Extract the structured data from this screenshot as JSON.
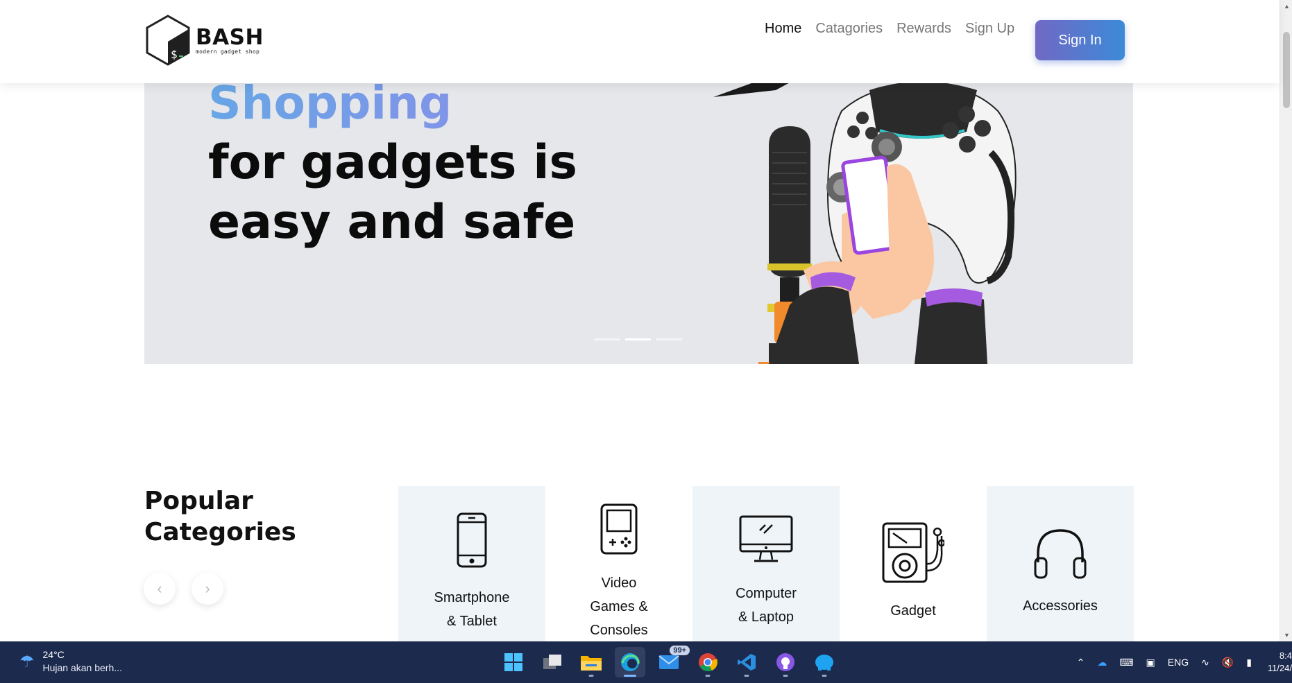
{
  "brand": {
    "name": "BASH",
    "tagline": "modern gadget shop"
  },
  "nav": {
    "items": [
      {
        "label": "Home",
        "active": true
      },
      {
        "label": "Catagories",
        "active": false
      },
      {
        "label": "Rewards",
        "active": false
      },
      {
        "label": "Sign Up",
        "active": false
      }
    ],
    "signin_label": "Sign In"
  },
  "hero": {
    "accent": "Shopping",
    "line1": "for gadgets is",
    "line2": "easy and safe",
    "slides": 3,
    "active_slide": 2
  },
  "popular": {
    "title_line1": "Popular",
    "title_line2": "Categories",
    "prev_icon": "chevron-left-icon",
    "next_icon": "chevron-right-icon",
    "categories": [
      {
        "icon": "smartphone-icon",
        "line1": "Smartphone",
        "line2": "& Tablet"
      },
      {
        "icon": "handheld-console-icon",
        "line1": "Video",
        "line2": "Games &",
        "line3": "Consoles"
      },
      {
        "icon": "desktop-computer-icon",
        "line1": "Computer",
        "line2": "& Laptop"
      },
      {
        "icon": "music-player-icon",
        "line1": "Gadget"
      },
      {
        "icon": "headphones-icon",
        "line1": "Accessories"
      }
    ]
  },
  "taskbar": {
    "weather": {
      "temp": "24°C",
      "desc": "Hujan akan berh..."
    },
    "apps": [
      "windows-start-icon",
      "task-view-icon",
      "file-explorer-icon",
      "edge-icon",
      "mail-icon",
      "chrome-icon",
      "vscode-icon",
      "github-icon",
      "app-icon"
    ],
    "mail_badge": "99+",
    "tray": {
      "language": "ENG",
      "time": "8:4",
      "date": "11/24/"
    }
  },
  "colors": {
    "accent_gradient_start": "#7169c4",
    "accent_gradient_end": "#3c8ad8",
    "hero_bg": "#e5e7ea",
    "card_shade": "#eef4f8",
    "taskbar_bg": "#1c2a4e"
  }
}
